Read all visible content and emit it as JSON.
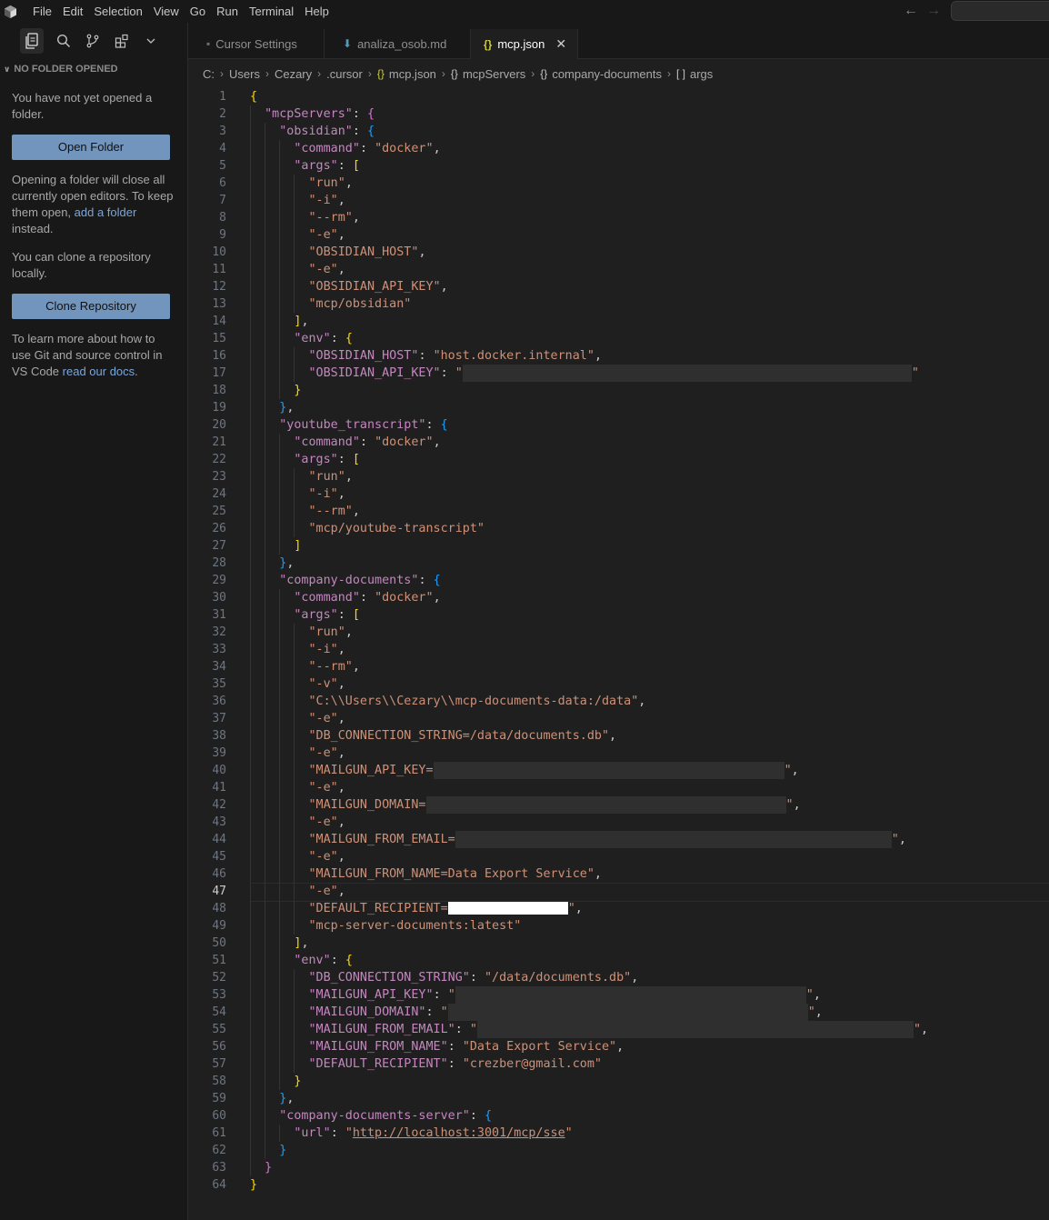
{
  "menu": [
    "File",
    "Edit",
    "Selection",
    "View",
    "Go",
    "Run",
    "Terminal",
    "Help"
  ],
  "sidebar": {
    "header": "NO FOLDER OPENED",
    "not_opened": "You have not yet opened a folder.",
    "open_folder_button": "Open Folder",
    "opening_text_1": "Opening a folder will close all currently open editors. To keep them open, ",
    "opening_link": "add a folder",
    "opening_text_2": " instead.",
    "clone_text": "You can clone a repository locally.",
    "clone_button": "Clone Repository",
    "learn_text": "To learn more about how to use Git and source control in VS Code ",
    "learn_link": "read our docs",
    "learn_end": "."
  },
  "tabs": [
    {
      "label": "Cursor Settings",
      "icon": "cursor-settings-icon",
      "active": false
    },
    {
      "label": "analiza_osob.md",
      "icon": "markdown-icon",
      "active": false
    },
    {
      "label": "mcp.json",
      "icon": "json-icon",
      "active": true
    }
  ],
  "breadcrumb": [
    "C:",
    "Users",
    "Cezary",
    ".cursor",
    "mcp.json",
    "mcpServers",
    "company-documents",
    "args"
  ],
  "current_line": 47,
  "code": {
    "mcpServers": "\"mcpServers\"",
    "obsidian": "\"obsidian\"",
    "command": "\"command\"",
    "docker": "\"docker\"",
    "args": "\"args\"",
    "env": "\"env\"",
    "run": "\"run\"",
    "i": "\"-i\"",
    "rm": "\"--rm\"",
    "e": "\"-e\"",
    "v": "\"-v\"",
    "obsidian_host_arg": "\"OBSIDIAN_HOST\"",
    "obsidian_api_key_arg": "\"OBSIDIAN_API_KEY\"",
    "mcp_obsidian": "\"mcp/obsidian\"",
    "obsidian_host_key": "\"OBSIDIAN_HOST\"",
    "obsidian_host_val": "\"host.docker.internal\"",
    "obsidian_api_key_key": "\"OBSIDIAN_API_KEY\"",
    "youtube_transcript": "\"youtube_transcript\"",
    "mcp_youtube": "\"mcp/youtube-transcript\"",
    "company_documents": "\"company-documents\"",
    "volume": "\"C:\\\\Users\\\\Cezary\\\\mcp-documents-data:/data\"",
    "db_conn_arg": "\"DB_CONNECTION_STRING=/data/documents.db\"",
    "mailgun_api_key_arg": "\"MAILGUN_API_KEY=",
    "mailgun_domain_arg": "\"MAILGUN_DOMAIN=",
    "mailgun_from_email_arg": "\"MAILGUN_FROM_EMAIL=",
    "mailgun_from_name_arg": "\"MAILGUN_FROM_NAME=Data Export Service\"",
    "default_recipient_arg": "\"DEFAULT_RECIPIENT=",
    "image": "\"mcp-server-documents:latest\"",
    "db_conn_key": "\"DB_CONNECTION_STRING\"",
    "db_conn_val": "\"/data/documents.db\"",
    "mailgun_api_key_key": "\"MAILGUN_API_KEY\"",
    "mailgun_domain_key": "\"MAILGUN_DOMAIN\"",
    "mailgun_from_email_key": "\"MAILGUN_FROM_EMAIL\"",
    "mailgun_from_name_key": "\"MAILGUN_FROM_NAME\"",
    "mailgun_from_name_val": "\"Data Export Service\"",
    "default_recipient_key": "\"DEFAULT_RECIPIENT\"",
    "default_recipient_val": "\"crezber@gmail.com\"",
    "company_documents_server": "\"company-documents-server\"",
    "url_key": "\"url\"",
    "url_val": "http://localhost:3001/mcp/sse"
  },
  "colors": {
    "editor_bg": "#1f1f1f",
    "key": "#c586c0",
    "string": "#ce9178",
    "bracket_level_1": "#ffd700",
    "bracket_level_2": "#da70d6",
    "bracket_level_3": "#179fff"
  }
}
